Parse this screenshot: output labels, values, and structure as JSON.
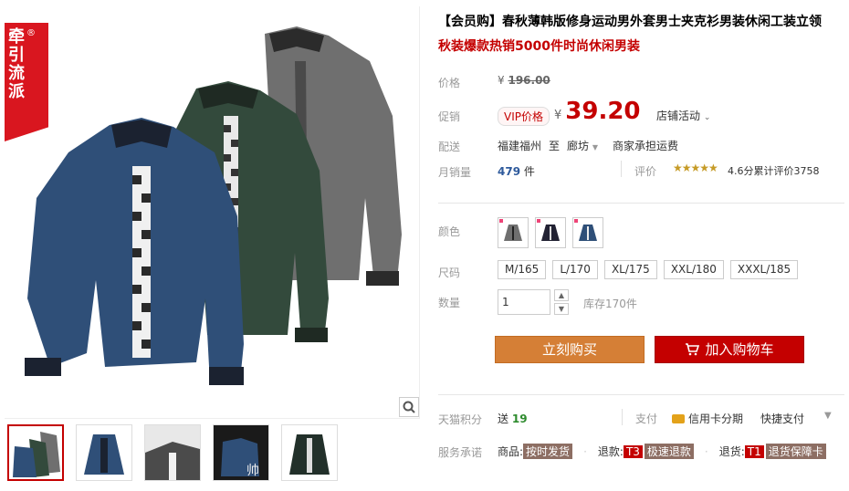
{
  "ribbon": {
    "line1": "牵引流派",
    "chars": [
      "牵",
      "引",
      "流",
      "派"
    ],
    "reg": "®"
  },
  "product": {
    "title": "【会员购】春秋薄韩版修身运动男外套男士夹克衫男装休闲工装立领",
    "subtitle": "秋装爆款热销5000件时尚休闲男装"
  },
  "price": {
    "label": "价格",
    "yen": "¥",
    "original": "196.00",
    "promo_label": "促销",
    "vip_tag": "VIP价格",
    "current": "39.20",
    "shop_activity": "店铺活动"
  },
  "shipping": {
    "label": "配送",
    "from": "福建福州",
    "to_word": "至",
    "dest": "廊坊",
    "fee": "商家承担运费"
  },
  "sales": {
    "label": "月销量",
    "count": "479",
    "unit": "件",
    "review_label": "评价",
    "stars": "★★★★★",
    "rating_text": "4.6分累计评价3758"
  },
  "options": {
    "color_label": "颜色",
    "colors": [
      "gray",
      "black",
      "blue"
    ],
    "size_label": "尺码",
    "sizes": [
      "M/165",
      "L/170",
      "XL/175",
      "XXL/180",
      "XXXL/185"
    ],
    "qty_label": "数量",
    "qty_value": "1",
    "stock": "库存170件"
  },
  "actions": {
    "buy_now": "立刻购买",
    "add_cart": "加入购物车"
  },
  "service": {
    "points_label": "天猫积分",
    "points_prefix": "送",
    "points_value": "19",
    "pay_label": "支付",
    "credit": "信用卡分期",
    "quickpay": "快捷支付",
    "promise_label": "服务承诺",
    "p1_prefix": "商品:",
    "p1_tag": "按时发货",
    "p2_prefix": "退款:",
    "p2_code": "T3",
    "p2_tag": "极速退款",
    "p3_prefix": "退货:",
    "p3_code": "T1",
    "p3_tag": "退货保障卡"
  },
  "colors": {
    "accent": "#c40000",
    "buy": "#d57f36",
    "link": "#2e5a9c"
  }
}
